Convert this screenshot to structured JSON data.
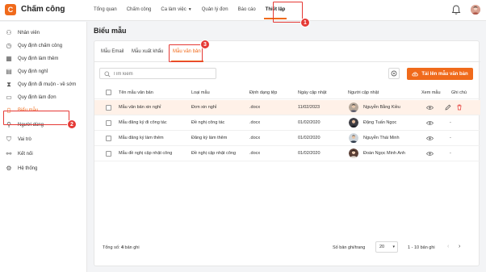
{
  "app": {
    "logo_glyph": "C",
    "name": "Chấm công"
  },
  "nav": [
    {
      "label": "Tổng quan",
      "caret": false
    },
    {
      "label": "Chấm công",
      "caret": false
    },
    {
      "label": "Ca làm việc",
      "caret": true
    },
    {
      "label": "Quản lý đơn",
      "caret": false
    },
    {
      "label": "Báo cáo",
      "caret": false
    },
    {
      "label": "Thiết lập",
      "caret": false,
      "active": true
    }
  ],
  "sidebar": {
    "items": [
      {
        "label": "Nhân viên",
        "icon": "users-icon"
      },
      {
        "label": "Quy định chấm công",
        "icon": "clock-icon"
      },
      {
        "label": "Quy định làm thêm",
        "icon": "calendar-icon"
      },
      {
        "label": "Quy định nghỉ",
        "icon": "leave-icon"
      },
      {
        "label": "Quy định đi muộn - về sớm",
        "icon": "hourglass-icon"
      },
      {
        "label": "Quy định làm đơn",
        "icon": "form-icon"
      },
      {
        "label": "Biểu mẫu",
        "icon": "document-icon",
        "active": true
      },
      {
        "label": "Người dùng",
        "icon": "user-icon"
      },
      {
        "label": "Vai trò",
        "icon": "shield-icon"
      },
      {
        "label": "Kết nối",
        "icon": "connect-icon"
      },
      {
        "label": "Hệ thống",
        "icon": "system-icon"
      }
    ]
  },
  "page": {
    "title": "Biểu mẫu"
  },
  "tabs": [
    {
      "label": "Mẫu Email"
    },
    {
      "label": "Mẫu xuất khẩu"
    },
    {
      "label": "Mẫu văn bản",
      "active": true
    }
  ],
  "search": {
    "placeholder": "Tìm kiếm"
  },
  "upload_button": {
    "label": "Tải lên mẫu văn bản"
  },
  "table": {
    "headers": [
      "Tên mẫu văn bản",
      "Loại mẫu",
      "Định dạng tệp",
      "Ngày cập nhật",
      "Người cập nhật",
      "Xem mẫu",
      "Ghi chú"
    ],
    "rows": [
      {
        "name": "Mẫu văn bản xin nghỉ",
        "type": "Đơn xin nghỉ",
        "format": ".docx",
        "date": "11/02/2023",
        "user": "Nguyễn Bằng Kiều",
        "note": "",
        "selected": true
      },
      {
        "name": "Mẫu đăng ký đi công tác",
        "type": "Đề nghị công tác",
        "format": ".docx",
        "date": "01/02/2020",
        "user": "Đặng Tuấn Ngọc",
        "note": "-",
        "selected": false
      },
      {
        "name": "Mẫu đăng ký làm thêm",
        "type": "Đăng ký làm thêm",
        "format": ".docx",
        "date": "01/02/2020",
        "user": "Nguyễn Thái Minh",
        "note": "-",
        "selected": false
      },
      {
        "name": "Mẫu đề nghị cập nhật công",
        "type": "Đề nghị cập nhật công",
        "format": ".docx",
        "date": "01/02/2020",
        "user": "Đoàn Ngọc Minh Anh",
        "note": "-",
        "selected": false
      }
    ]
  },
  "footer": {
    "total_prefix": "Tổng số: ",
    "total_count": "4",
    "total_suffix": " bản ghi",
    "per_page_label": "Số bản ghi/trang",
    "per_page_value": "20",
    "range": "1 - 10 bản ghi"
  },
  "annotations": [
    "1",
    "2",
    "3"
  ],
  "colors": {
    "accent": "#f06a1b",
    "annotation": "#e53935",
    "selected_row": "#fff1e8"
  }
}
